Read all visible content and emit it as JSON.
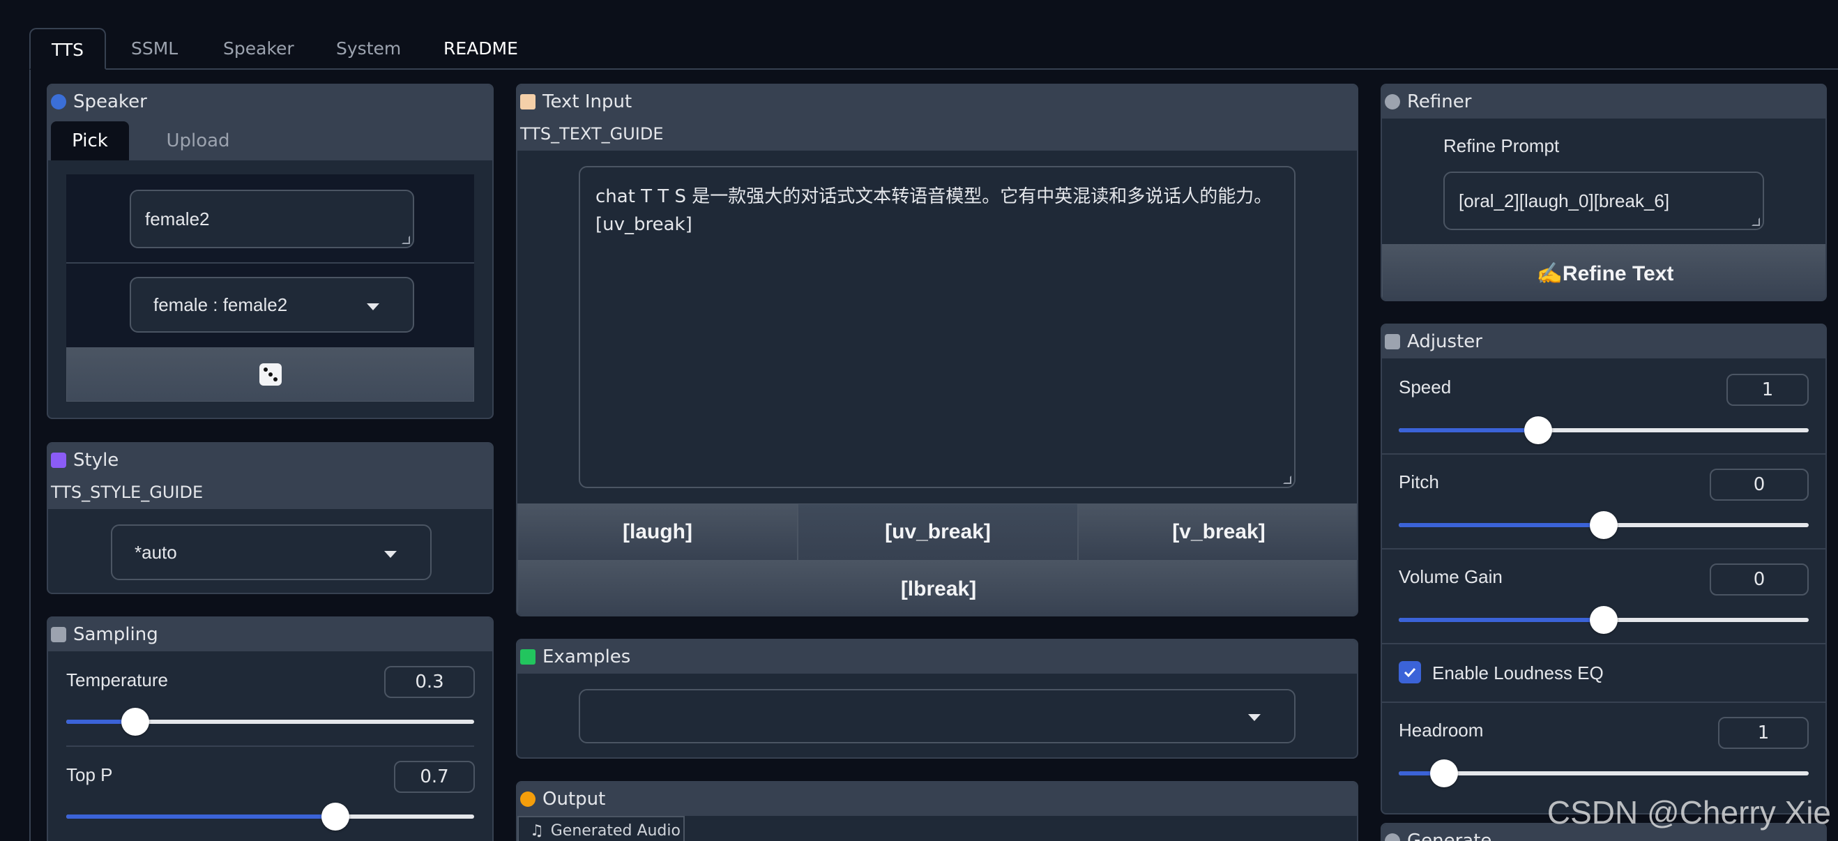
{
  "tabs": [
    "TTS",
    "SSML",
    "Speaker",
    "System",
    "README"
  ],
  "speaker": {
    "title": "Speaker",
    "subtabs": [
      "Pick",
      "Upload"
    ],
    "name_value": "female2",
    "select_value": "female : female2"
  },
  "style": {
    "title": "Style",
    "guide": "TTS_STYLE_GUIDE",
    "select_value": "*auto"
  },
  "sampling": {
    "title": "Sampling",
    "temperature_label": "Temperature",
    "temperature_value": "0.3",
    "temperature_fraction": 0.17,
    "top_p_label": "Top P",
    "top_p_value": "0.7",
    "top_p_fraction": 0.66
  },
  "text_input": {
    "title": "Text Input",
    "guide": "TTS_TEXT_GUIDE",
    "value": "chat T T S 是一款强大的对话式文本转语音模型。它有中英混读和多说话人的能力。 [uv_break]",
    "buttons": [
      "[laugh]",
      "[uv_break]",
      "[v_break]"
    ],
    "lbreak": "[lbreak]"
  },
  "examples": {
    "title": "Examples",
    "select_value": ""
  },
  "output": {
    "title": "Output",
    "audio_tab": "Generated Audio"
  },
  "refiner": {
    "title": "Refiner",
    "prompt_label": "Refine Prompt",
    "prompt_value": "[oral_2][laugh_0][break_6]",
    "button": "✍️Refine Text"
  },
  "adjuster": {
    "title": "Adjuster",
    "speed_label": "Speed",
    "speed_value": "1",
    "speed_fraction": 0.34,
    "pitch_label": "Pitch",
    "pitch_value": "0",
    "pitch_fraction": 0.5,
    "volume_label": "Volume Gain",
    "volume_value": "0",
    "volume_fraction": 0.5,
    "loudness_label": "Enable Loudness EQ",
    "headroom_label": "Headroom",
    "headroom_value": "1",
    "headroom_fraction": 0.11
  },
  "generate": {
    "title": "Generate"
  },
  "watermark": "CSDN @Cherry Xie"
}
